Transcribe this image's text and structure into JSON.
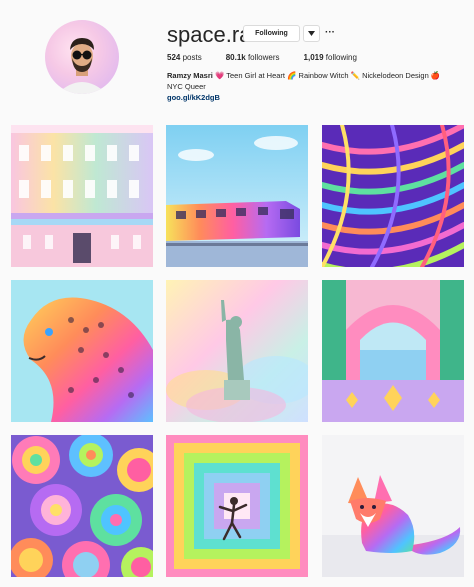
{
  "profile": {
    "username": "space.ram",
    "following_button": "Following",
    "more_label": "···",
    "stats": {
      "posts_value": "524",
      "posts_label": " posts",
      "followers_value": "80.1k",
      "followers_label": " followers",
      "following_value": "1,019",
      "following_label": " following"
    },
    "bio": {
      "name": "Ramzy Masri",
      "heart": "💗",
      "line1_a": " Teen Girl at Heart ",
      "rainbow": "🌈",
      "line1_b": " Rainbow Witch ",
      "pencil": "✏️",
      "line1_c": " Nickelodeon Design ",
      "apple": "🍎",
      "line2": "NYC Queer",
      "link": "goo.gl/kK2dgB"
    }
  },
  "posts": [
    {
      "subject": "rainbow-palace"
    },
    {
      "subject": "rainbow-subway-train"
    },
    {
      "subject": "rainbow-palm-leaves"
    },
    {
      "subject": "rainbow-leopard"
    },
    {
      "subject": "statue-of-liberty-rainbow-clouds"
    },
    {
      "subject": "rainbow-archway-tiles"
    },
    {
      "subject": "rainbow-succulents"
    },
    {
      "subject": "rainbow-tunnel-dancer"
    },
    {
      "subject": "rainbow-fox"
    }
  ],
  "colors": {
    "background": "#fafafa",
    "text": "#262626",
    "link": "#003569",
    "border": "#dbdbdb"
  }
}
